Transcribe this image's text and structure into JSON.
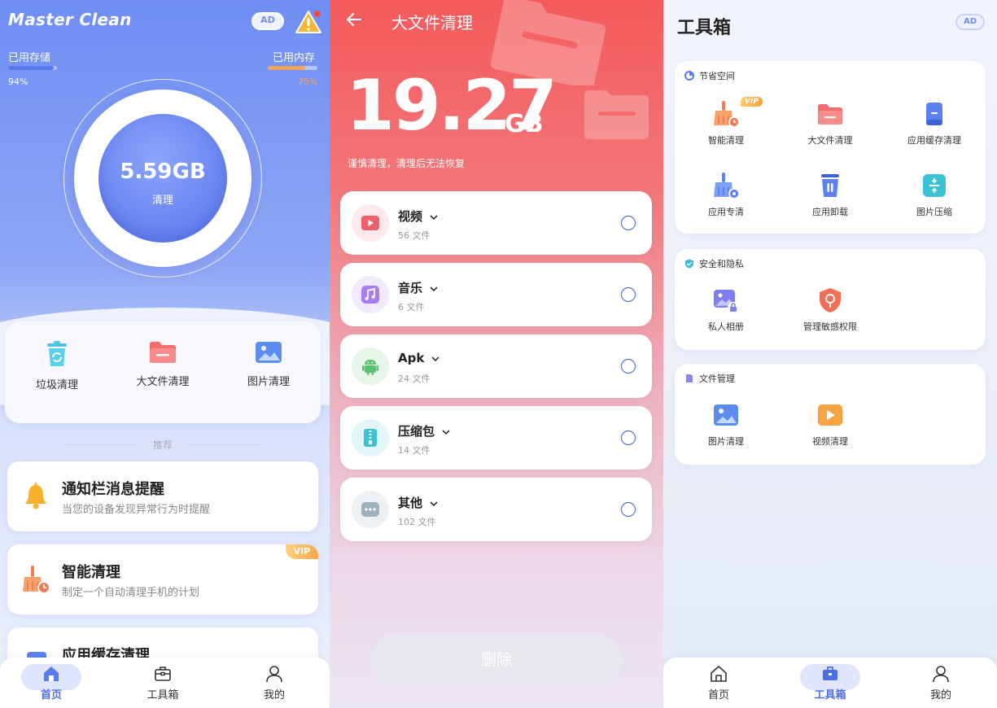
{
  "home": {
    "app_title": "Master Clean",
    "ad_badge": "AD",
    "storage": {
      "label": "已用存储",
      "percent_text": "94%",
      "fraction": 0.94,
      "color": "#5a78ee"
    },
    "memory": {
      "label": "已用内存",
      "percent_text": "75%",
      "fraction": 0.75,
      "color": "#f5a45a"
    },
    "ring": {
      "size": "5.59GB",
      "label": "清理"
    },
    "quick_actions": [
      {
        "label": "垃圾清理",
        "icon": "trash-recycle-icon"
      },
      {
        "label": "大文件清理",
        "icon": "folder-icon"
      },
      {
        "label": "图片清理",
        "icon": "image-icon"
      }
    ],
    "section_title": "推荐",
    "recommendations": [
      {
        "title": "通知栏消息提醒",
        "desc": "当您的设备发现异常行为时提醒",
        "icon": "bell-icon"
      },
      {
        "title": "智能清理",
        "desc": "制定一个自动清理手机的计划",
        "icon": "broom-icon",
        "vip": "VIP"
      },
      {
        "title": "应用缓存清理",
        "desc": "",
        "icon": "app-cache-icon"
      }
    ],
    "nav": [
      {
        "label": "首页",
        "icon": "home-icon",
        "active": true
      },
      {
        "label": "工具箱",
        "icon": "toolbox-icon",
        "active": false
      },
      {
        "label": "我的",
        "icon": "profile-icon",
        "active": false
      }
    ]
  },
  "large_files": {
    "title": "大文件清理",
    "total_size": "19.27",
    "total_unit": "GB",
    "warning": "谨慎清理，清理后无法恢复",
    "categories": [
      {
        "name": "视频",
        "count": "56 文件",
        "icon": "video-icon",
        "color": "#f0606a",
        "bg": "#fde9ec"
      },
      {
        "name": "音乐",
        "count": "6 文件",
        "icon": "music-icon",
        "color": "#a77df5",
        "bg": "#f1eafd"
      },
      {
        "name": "Apk",
        "count": "24 文件",
        "icon": "android-icon",
        "color": "#5cc16c",
        "bg": "#e5f5e8"
      },
      {
        "name": "压缩包",
        "count": "14 文件",
        "icon": "zip-icon",
        "color": "#3cc2d6",
        "bg": "#e2f5f8"
      },
      {
        "name": "其他",
        "count": "102 文件",
        "icon": "more-icon",
        "color": "#9fb1bd",
        "bg": "#edf1f3"
      }
    ],
    "delete_label": "删除"
  },
  "toolbox": {
    "title": "工具箱",
    "ad_badge": "AD",
    "sections": [
      {
        "title": "节省空间",
        "items": [
          {
            "label": "智能清理",
            "icon": "broom-icon",
            "vip": "VIP"
          },
          {
            "label": "大文件清理",
            "icon": "folder-icon"
          },
          {
            "label": "应用缓存清理",
            "icon": "app-cache-icon"
          },
          {
            "label": "应用专清",
            "icon": "app-clean-icon"
          },
          {
            "label": "应用卸载",
            "icon": "uninstall-icon"
          },
          {
            "label": "图片压缩",
            "icon": "compress-icon"
          }
        ]
      },
      {
        "title": "安全和隐私",
        "items": [
          {
            "label": "私人相册",
            "icon": "private-album-icon"
          },
          {
            "label": "管理敏感权限",
            "icon": "shield-permission-icon"
          }
        ]
      },
      {
        "title": "文件管理",
        "items": [
          {
            "label": "图片清理",
            "icon": "image-icon"
          },
          {
            "label": "视频清理",
            "icon": "video-play-icon"
          }
        ]
      }
    ],
    "nav": [
      {
        "label": "首页",
        "icon": "home-icon",
        "active": false
      },
      {
        "label": "工具箱",
        "icon": "toolbox-icon",
        "active": true
      },
      {
        "label": "我的",
        "icon": "profile-icon",
        "active": false
      }
    ]
  }
}
